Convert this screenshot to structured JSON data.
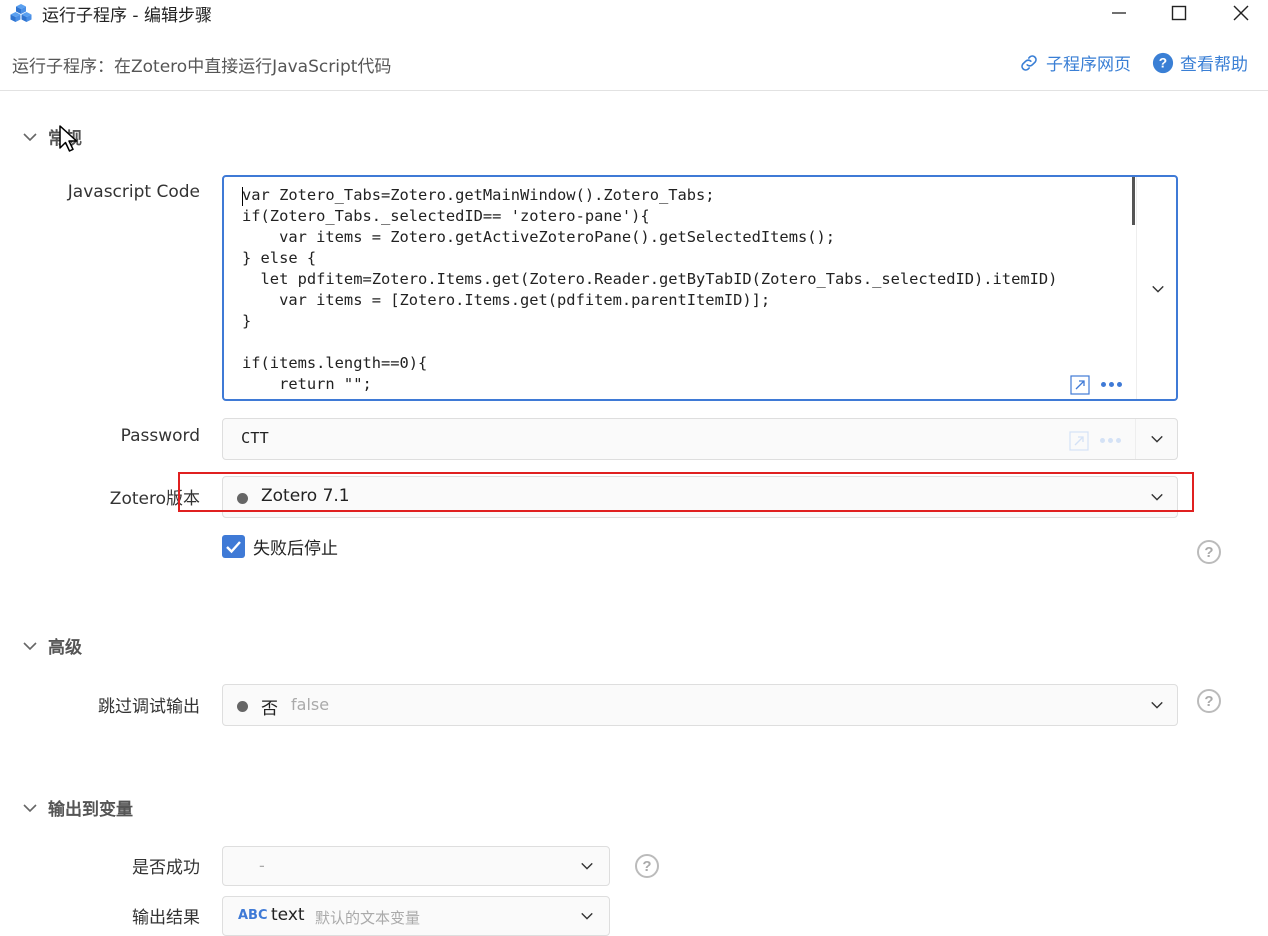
{
  "window": {
    "title": "运行子程序 - 编辑步骤",
    "subtitle": "运行子程序：在Zotero中直接运行JavaScript代码",
    "link_subprogram": "子程序网页",
    "link_help": "查看帮助"
  },
  "sections": {
    "general": "常规",
    "advanced": "高级",
    "output": "输出到变量"
  },
  "fields": {
    "js_code": {
      "label": "Javascript Code",
      "lines": [
        "var Zotero_Tabs=Zotero.getMainWindow().Zotero_Tabs;",
        "if(Zotero_Tabs._selectedID== 'zotero-pane'){",
        "    var items = Zotero.getActiveZoteroPane().getSelectedItems();",
        "} else {",
        "  let pdfitem=Zotero.Items.get(Zotero.Reader.getByTabID(Zotero_Tabs._selectedID).itemID)",
        "    var items = [Zotero.Items.get(pdfitem.parentItemID)];",
        "}",
        "",
        "if(items.length==0){",
        "    return \"\";"
      ]
    },
    "password": {
      "label": "Password",
      "value": "CTT"
    },
    "zotero_version": {
      "label": "Zotero版本",
      "value": "Zotero 7.1"
    },
    "stop_on_fail": {
      "label": "失败后停止",
      "checked": true
    },
    "skip_debug": {
      "label": "跳过调试输出",
      "value": "否",
      "hint": "false"
    },
    "success": {
      "label": "是否成功",
      "value": "-"
    },
    "result": {
      "label": "输出结果",
      "type_badge": "ABC",
      "value": "text",
      "hint": "默认的文本变量"
    }
  },
  "colors": {
    "accent": "#3f7ad6",
    "highlight_box": "#e02020",
    "link": "#3a7fd5"
  },
  "icons": [
    "app-cubes-icon",
    "minimize-icon",
    "maximize-icon",
    "close-icon",
    "link-icon",
    "question-circle-icon",
    "chevron-down-icon",
    "expand-arrow-icon",
    "more-dots-icon",
    "checkbox-checked-icon",
    "help-circle-icon",
    "mouse-cursor-icon"
  ]
}
